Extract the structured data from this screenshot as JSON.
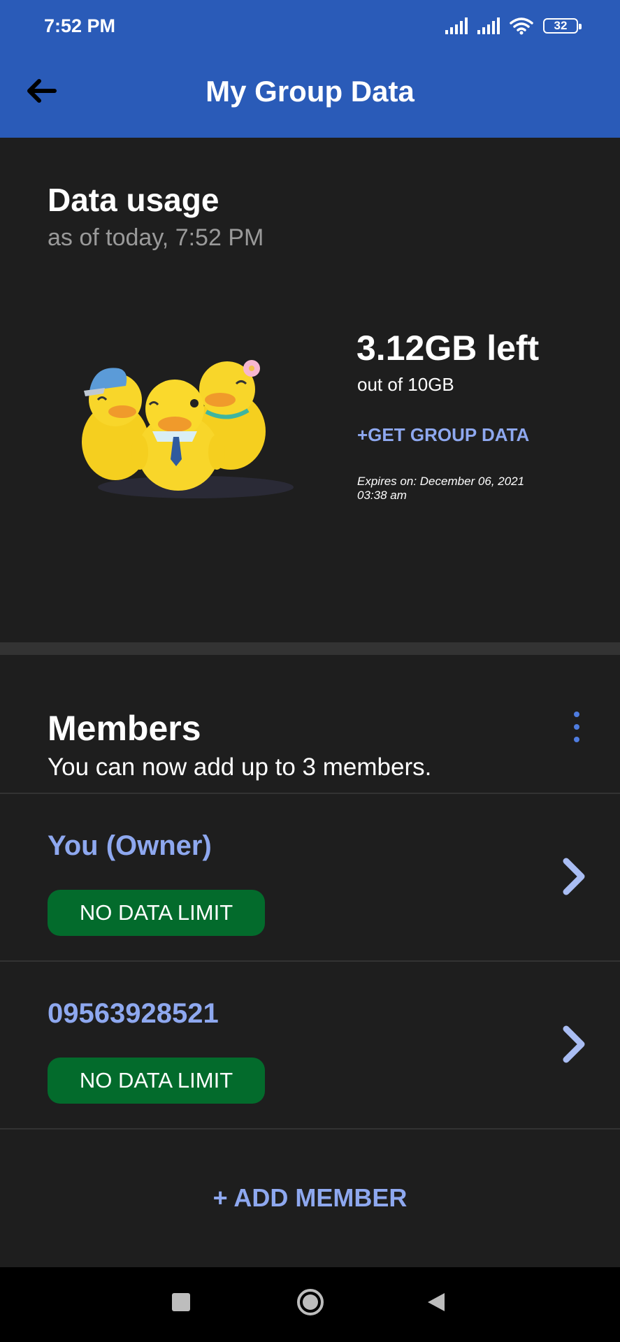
{
  "status_bar": {
    "time": "7:52 PM",
    "battery": "32"
  },
  "app_bar": {
    "title": "My Group Data"
  },
  "usage": {
    "title": "Data usage",
    "as_of": "as of today, 7:52 PM",
    "remaining": "3.12GB left",
    "total": "out of 10GB",
    "get_data_label": "+GET GROUP DATA",
    "expires_line1": "Expires on: December 06, 2021",
    "expires_line2": "03:38 am"
  },
  "members": {
    "title": "Members",
    "subtitle": "You can now add up to 3 members.",
    "items": [
      {
        "name": "You (Owner)",
        "limit": "NO DATA LIMIT"
      },
      {
        "name": "09563928521",
        "limit": "NO DATA LIMIT"
      }
    ],
    "add_label": "+ ADD MEMBER"
  },
  "icons": {
    "back": "arrow-left-icon",
    "menu": "kebab-menu-icon",
    "chevron": "chevron-right-icon",
    "nav_recents": "square-icon",
    "nav_home": "circle-icon",
    "nav_back": "triangle-back-icon"
  },
  "colors": {
    "app_bar": "#2a5bb8",
    "background": "#1e1e1e",
    "accent_text": "#8ea8ef",
    "badge_green": "#036b2c"
  }
}
